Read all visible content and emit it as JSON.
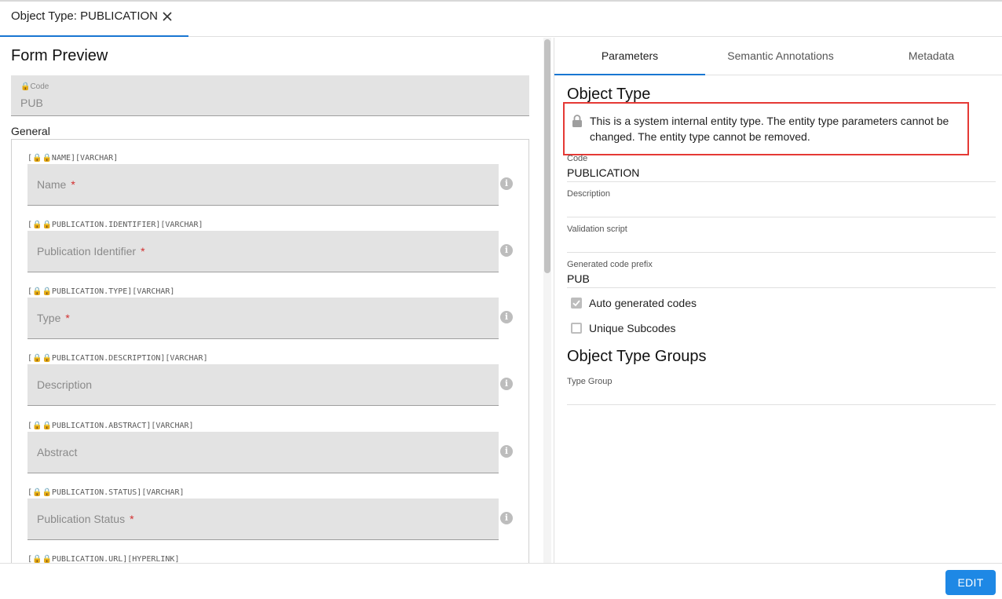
{
  "tab": {
    "label": "Object Type: PUBLICATION"
  },
  "form_preview": {
    "title": "Form Preview",
    "code": {
      "label": "🔒Code",
      "value": "PUB"
    },
    "section": "General",
    "properties": [
      {
        "meta": "[🔒🔒NAME][VARCHAR]",
        "label": "Name",
        "required": "*"
      },
      {
        "meta": "[🔒🔒PUBLICATION.IDENTIFIER][VARCHAR]",
        "label": "Publication Identifier",
        "required": "*"
      },
      {
        "meta": "[🔒🔒PUBLICATION.TYPE][VARCHAR]",
        "label": "Type",
        "required": "*"
      },
      {
        "meta": "[🔒🔒PUBLICATION.DESCRIPTION][VARCHAR]",
        "label": "Description",
        "required": ""
      },
      {
        "meta": "[🔒🔒PUBLICATION.ABSTRACT][VARCHAR]",
        "label": "Abstract",
        "required": ""
      },
      {
        "meta": "[🔒🔒PUBLICATION.STATUS][VARCHAR]",
        "label": "Publication Status",
        "required": "*"
      },
      {
        "meta": "[🔒🔒PUBLICATION.URL][HYPERLINK]",
        "label": "",
        "required": ""
      }
    ]
  },
  "right_tabs": [
    "Parameters",
    "Semantic Annotations",
    "Metadata"
  ],
  "object_type": {
    "heading": "Object Type",
    "warning": "This is a system internal entity type. The entity type parameters cannot be changed. The entity type cannot be removed.",
    "code_label": "Code",
    "code_value": "PUBLICATION",
    "description_label": "Description",
    "description_value": "",
    "validation_label": "Validation script",
    "validation_value": "",
    "prefix_label": "Generated code prefix",
    "prefix_value": "PUB",
    "auto_codes_label": "Auto generated codes",
    "auto_codes_checked": true,
    "unique_subcodes_label": "Unique Subcodes",
    "unique_subcodes_checked": false
  },
  "groups": {
    "heading": "Object Type Groups",
    "type_group_label": "Type Group",
    "type_group_value": ""
  },
  "footer": {
    "edit_label": "EDIT"
  },
  "colors": {
    "accent": "#1976d2",
    "button": "#1e88e5",
    "warning_border": "#e53935",
    "required": "#d32f2f"
  }
}
